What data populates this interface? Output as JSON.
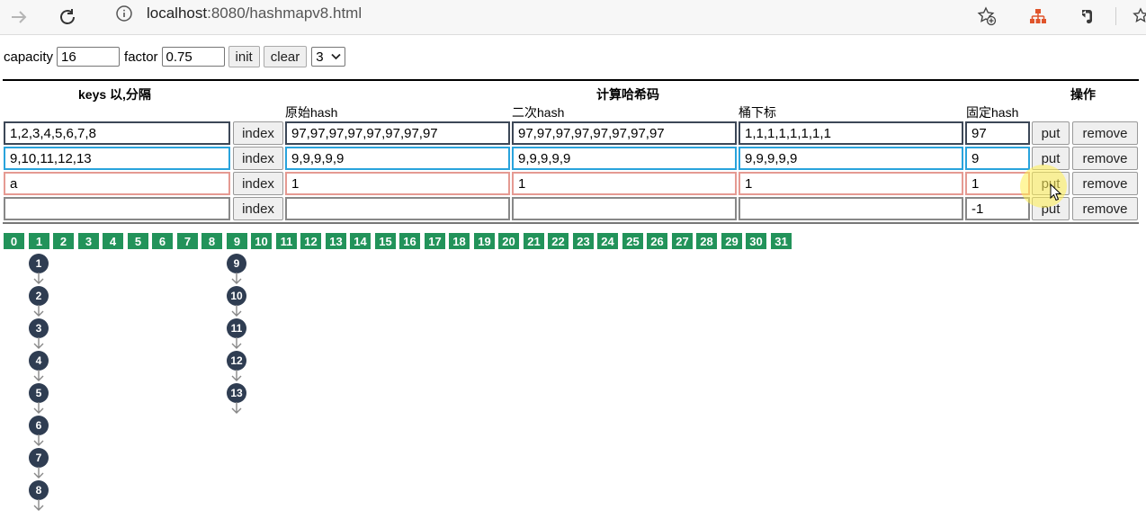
{
  "browser": {
    "url_host": "localhost",
    "url_path": ":8080/hashmapv8.html"
  },
  "controls": {
    "capacity_label": "capacity",
    "capacity_value": "16",
    "factor_label": "factor",
    "factor_value": "0.75",
    "init_label": "init",
    "clear_label": "clear",
    "version_value": "3"
  },
  "table": {
    "keys_header": "keys 以,分隔",
    "compute_header": "计算哈希码",
    "ops_header": "操作",
    "col_raw_hash": "原始hash",
    "col_second_hash": "二次hash",
    "col_bucket_index": "桶下标",
    "col_fixed_hash": "固定hash",
    "index_label": "index",
    "put_label": "put",
    "remove_label": "remove",
    "rows": [
      {
        "keys": "1,2,3,4,5,6,7,8",
        "raw": "97,97,97,97,97,97,97,97",
        "second": "97,97,97,97,97,97,97,97",
        "bucket": "1,1,1,1,1,1,1,1",
        "fixed": "97"
      },
      {
        "keys": "9,10,11,12,13",
        "raw": "9,9,9,9,9",
        "second": "9,9,9,9,9",
        "bucket": "9,9,9,9,9",
        "fixed": "9"
      },
      {
        "keys": "a",
        "raw": "1",
        "second": "1",
        "bucket": "1",
        "fixed": "1"
      },
      {
        "keys": "",
        "raw": "",
        "second": "",
        "bucket": "",
        "fixed": "-1"
      }
    ]
  },
  "buckets": [
    "0",
    "1",
    "2",
    "3",
    "4",
    "5",
    "6",
    "7",
    "8",
    "9",
    "10",
    "11",
    "12",
    "13",
    "14",
    "15",
    "16",
    "17",
    "18",
    "19",
    "20",
    "21",
    "22",
    "23",
    "24",
    "25",
    "26",
    "27",
    "28",
    "29",
    "30",
    "31"
  ],
  "chains": [
    {
      "bucket_index": 1,
      "nodes": [
        "1",
        "2",
        "3",
        "4",
        "5",
        "6",
        "7",
        "8"
      ]
    },
    {
      "bucket_index": 9,
      "nodes": [
        "9",
        "10",
        "11",
        "12",
        "13"
      ]
    }
  ],
  "colors": {
    "bucket": "#22935a",
    "node": "#2f3d52",
    "row1_border": "#3c4757",
    "row2_border": "#29a3dc",
    "row3_border": "#e59a92"
  }
}
